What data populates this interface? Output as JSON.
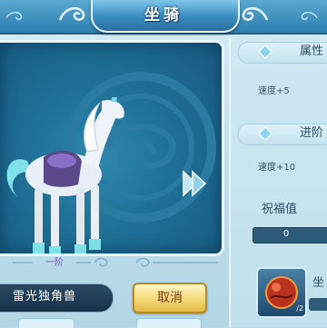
{
  "window": {
    "title": "坐骑"
  },
  "mount": {
    "tier": "一阶",
    "name": "雷光独角兽"
  },
  "buttons": {
    "cancel": "取消"
  },
  "attributes": {
    "header": "属性",
    "stat": "速度+5"
  },
  "advance": {
    "header": "进阶",
    "stat": "速度+10"
  },
  "blessing": {
    "label": "祝福值",
    "value": "0"
  },
  "item": {
    "count": "/2"
  },
  "side": {
    "label": "坐"
  },
  "icons": [
    "swirl-ornament-icon",
    "next-arrow-icon",
    "section-diamond-icon",
    "orb-item-icon"
  ],
  "colors": {
    "title_blue": "#2d7fb0",
    "panel_teal": "#1f6f96",
    "cancel_gold": "#f4d977",
    "tier_purple": "#7a4fc8"
  }
}
